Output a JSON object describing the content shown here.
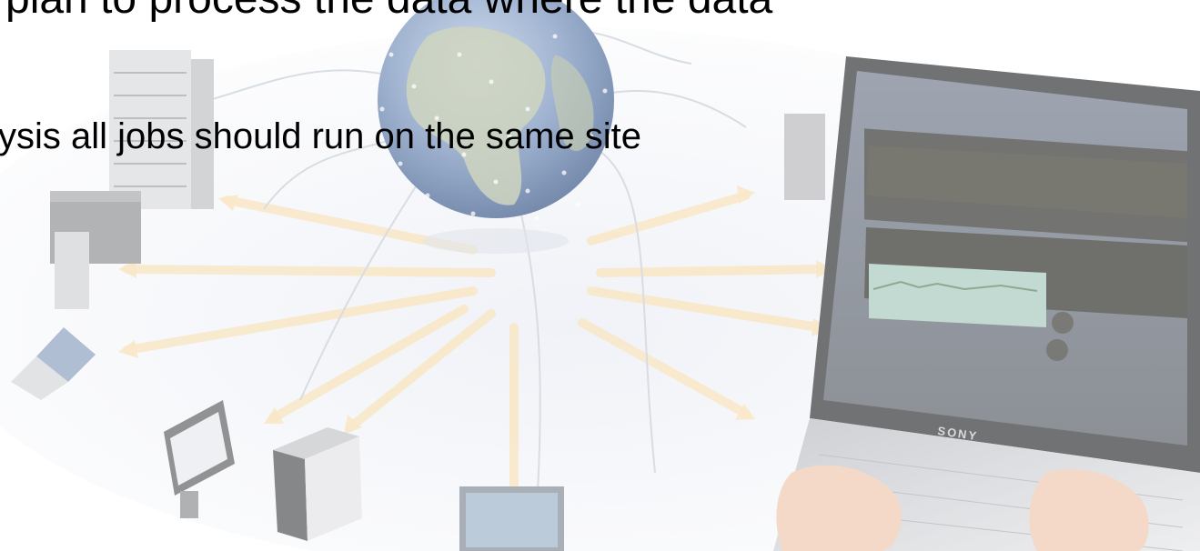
{
  "slide": {
    "headline_partial": "plan to process the data where the data",
    "bullet_partial": "ysis all jobs should run on the same site"
  },
  "illustration": {
    "laptop_brand": "SONY",
    "icons": [
      "globe-icon",
      "server-rack-icon",
      "tower-pc-icon",
      "laptop-icon",
      "monitor-icon",
      "arrow-icon",
      "hand-icon"
    ]
  },
  "colors": {
    "arrow": "#f6deb0",
    "globe_ocean": "#5f7fae",
    "globe_land": "#b9c2a2",
    "floor": "#eef0f6",
    "screen_dark": "#2e2e2a"
  }
}
